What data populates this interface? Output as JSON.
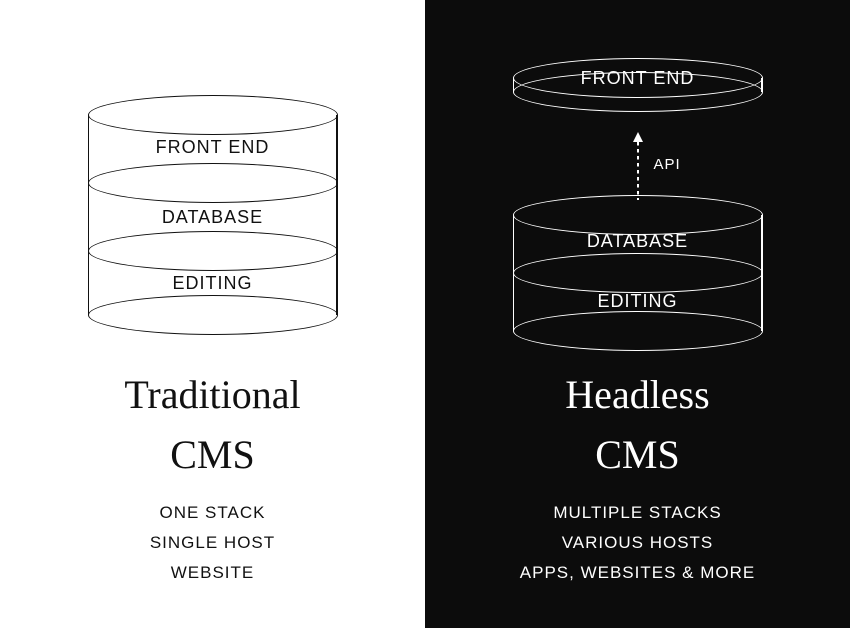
{
  "left": {
    "layers": [
      "FRONT END",
      "DATABASE",
      "EDITING"
    ],
    "titleLine1": "Traditional",
    "titleLine2": "CMS",
    "features": [
      "ONE STACK",
      "SINGLE HOST",
      "WEBSITE"
    ]
  },
  "right": {
    "frontend": "FRONT END",
    "apiLabel": "API",
    "layers": [
      "DATABASE",
      "EDITING"
    ],
    "titleLine1": "Headless",
    "titleLine2": "CMS",
    "features": [
      "MULTIPLE STACKS",
      "VARIOUS HOSTS",
      "APPS, WEBSITES & MORE"
    ]
  }
}
